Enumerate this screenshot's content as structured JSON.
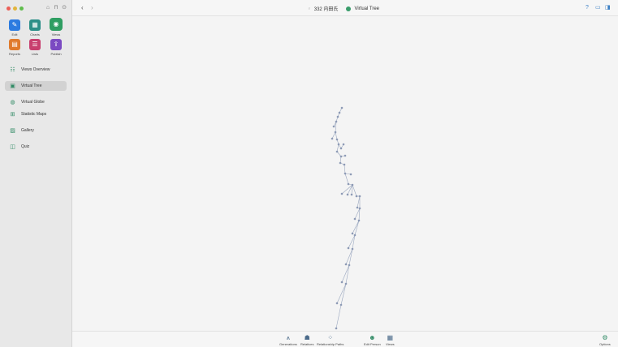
{
  "sidebar": {
    "tiles": [
      {
        "label": "Edit",
        "glyph": "✎",
        "color": "#2c7be0"
      },
      {
        "label": "Charts",
        "glyph": "▦",
        "color": "#2c8f88"
      },
      {
        "label": "Views",
        "glyph": "◉",
        "color": "#2f9e62"
      },
      {
        "label": "Reports",
        "glyph": "▤",
        "color": "#e07a2c"
      },
      {
        "label": "Lists",
        "glyph": "☰",
        "color": "#c83f6e"
      },
      {
        "label": "Publish",
        "glyph": "⇪",
        "color": "#7b4ac2"
      }
    ],
    "items": [
      {
        "label": "Views Overview",
        "glyph": "☷"
      },
      {
        "label": "Virtual Tree",
        "glyph": "▣"
      },
      {
        "label": "Virtual Globe",
        "glyph": "◍"
      },
      {
        "label": "Statistic Maps",
        "glyph": "⊞"
      },
      {
        "label": "Gallery",
        "glyph": "▨"
      },
      {
        "label": "Quiz",
        "glyph": "◫"
      }
    ]
  },
  "toolbar": {
    "person": "332 内田氏",
    "view_title": "Virtual Tree",
    "back_glyph": "‹",
    "forward_glyph": "›",
    "help_glyph": "?",
    "person_glyph": "♀"
  },
  "bottombar": {
    "items": [
      {
        "label": "Generations",
        "glyph": "⩚"
      },
      {
        "label": "Relatives",
        "glyph": "☗"
      },
      {
        "label": "Relationship Paths",
        "glyph": "⁘"
      },
      {
        "label": "Edit Person",
        "glyph": "☻"
      },
      {
        "label": "Views",
        "glyph": "▦"
      },
      {
        "label": "Options",
        "glyph": "⚙"
      }
    ]
  },
  "colors": {
    "accent": "#3a9d6b",
    "tree_line": "#9aa7bf",
    "tree_node": "#8d9ab5"
  }
}
